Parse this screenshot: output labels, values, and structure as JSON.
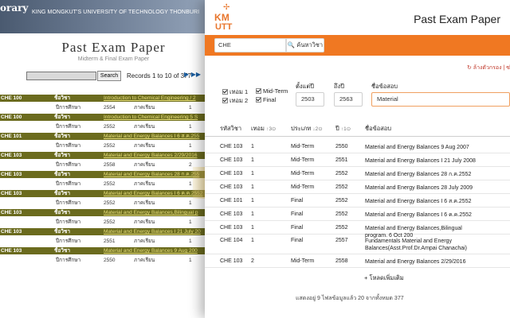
{
  "old_page": {
    "brand": "orary",
    "university": "KING MONGKUT'S UNIVERSITY OF TECHNOLOGY THONBURI",
    "title": "Past Exam Paper",
    "subtitle": "Midterm & Final Exam Paper",
    "search_button": "Search",
    "records_text": "Records 1 to 10 of 377",
    "nav_icons": "▶ ▶▶",
    "rows": [
      {
        "type": "h",
        "c1": "CHE 100",
        "c2": "ชื่อวิชา",
        "c3": "Introduction to Chemical Engineering / 2"
      },
      {
        "type": "d",
        "c2": "ปีการศึกษา",
        "c3": "2554",
        "c4": "ภาคเรียน",
        "c5": "1"
      },
      {
        "type": "h",
        "c1": "CHE 100",
        "c2": "ชื่อวิชา",
        "c3": "Introduction to Chemical Engineering 5 S"
      },
      {
        "type": "d",
        "c2": "ปีการศึกษา",
        "c3": "2552",
        "c4": "ภาคเรียน",
        "c5": "1"
      },
      {
        "type": "h",
        "c1": "CHE 101",
        "c2": "ชื่อวิชา",
        "c3": "Material and Energy Balances I 6 ส.ค.255"
      },
      {
        "type": "d",
        "c2": "ปีการศึกษา",
        "c3": "2552",
        "c4": "ภาคเรียน",
        "c5": "1"
      },
      {
        "type": "h",
        "c1": "CHE 103",
        "c2": "ชื่อวิชา",
        "c3": "Material and Energy Balances 2/29/2016"
      },
      {
        "type": "d",
        "c2": "ปีการศึกษา",
        "c3": "2558",
        "c4": "ภาคเรียน",
        "c5": "2"
      },
      {
        "type": "h",
        "c1": "CHE 103",
        "c2": "ชื่อวิชา",
        "c3": "Material and Energy Balances 28 ก.ค.255"
      },
      {
        "type": "d",
        "c2": "ปีการศึกษา",
        "c3": "2552",
        "c4": "ภาคเรียน",
        "c5": "1"
      },
      {
        "type": "h",
        "c1": "CHE 103",
        "c2": "ชื่อวิชา",
        "c3": "Material and Energy Balances I 6 ค.ค.2552"
      },
      {
        "type": "d",
        "c2": "ปีการศึกษา",
        "c3": "2552",
        "c4": "ภาคเรียน",
        "c5": "1"
      },
      {
        "type": "h",
        "c1": "CHE 103",
        "c2": "ชื่อวิชา",
        "c3": "Material and Energy Balances,Bilingual p"
      },
      {
        "type": "d",
        "c2": "ปีการศึกษา",
        "c3": "2552",
        "c4": "ภาคเรียน",
        "c5": "1"
      },
      {
        "type": "h",
        "c1": "CHE 103",
        "c2": "ชื่อวิชา",
        "c3": "Material and Energy Balances I 21 July 20"
      },
      {
        "type": "d",
        "c2": "ปีการศึกษา",
        "c3": "2551",
        "c4": "ภาคเรียน",
        "c5": "1"
      },
      {
        "type": "h",
        "c1": "CHE 103",
        "c2": "ชื่อวิชา",
        "c3": "Material and Energy Balances 9 Aug 200"
      },
      {
        "type": "d",
        "c2": "ปีการศึกษา",
        "c3": "2550",
        "c4": "ภาคเรียน",
        "c5": "1"
      }
    ]
  },
  "app": {
    "logo_text_top": "KM",
    "logo_text_bottom": "UTT",
    "title": "Past Exam Paper",
    "search": {
      "value": "CHE",
      "button": "🔍 ค้นหาวิชา"
    },
    "clear_filter": "↻ ล้างตัวกรอง | ซ่",
    "filters": {
      "checkbox_labels": [
        "เทอม 1",
        "เทอม 2",
        "Mid-Term",
        "Final"
      ],
      "from_label": "ตั้งแต่ปี",
      "from_value": "2503",
      "to_label": "ถึงปี",
      "to_value": "2563",
      "name_label": "ชื่อข้อสอบ",
      "name_value": "Material"
    },
    "table": {
      "headers": [
        {
          "label": "รหัสวิชา",
          "sort": ""
        },
        {
          "label": "เทอม",
          "sort": "↑3⊙"
        },
        {
          "label": "ประเภท",
          "sort": "↓2⊙"
        },
        {
          "label": "ปี",
          "sort": "↑1⊙"
        },
        {
          "label": "ชื่อข้อสอบ",
          "sort": ""
        }
      ],
      "rows": [
        {
          "code": "CHE 103",
          "term": "1",
          "type": "Mid-Term",
          "year": "2550",
          "name": "Material and Energy Balances 9 Aug 2007",
          "tall": false
        },
        {
          "code": "CHE 103",
          "term": "1",
          "type": "Mid-Term",
          "year": "2551",
          "name": "Material and Energy Balances I 21 July 2008",
          "tall": false
        },
        {
          "code": "CHE 103",
          "term": "1",
          "type": "Mid-Term",
          "year": "2552",
          "name": "Material and Energy Balances 28 ก.ค.2552",
          "tall": false
        },
        {
          "code": "CHE 103",
          "term": "1",
          "type": "Mid-Term",
          "year": "2552",
          "name": "Material and Energy Balances 28 July 2009",
          "tall": false
        },
        {
          "code": "CHE 101",
          "term": "1",
          "type": "Final",
          "year": "2552",
          "name": "Material and Energy Balances I 6 ส.ค.2552",
          "tall": false
        },
        {
          "code": "CHE 103",
          "term": "1",
          "type": "Final",
          "year": "2552",
          "name": "Material and Energy Balances I 6 ค.ค.2552",
          "tall": false
        },
        {
          "code": "CHE 103",
          "term": "1",
          "type": "Final",
          "year": "2552",
          "name": "Material and Energy Balances,Bilingual program. 6 Oct 200",
          "tall": false
        },
        {
          "code": "CHE 104",
          "term": "1",
          "type": "Final",
          "year": "2557",
          "name": "Fundamentals Material and Energy Balances(Asst.Prof.Dr.Ampai Chanachai)",
          "tall": true
        },
        {
          "code": "CHE 103",
          "term": "2",
          "type": "Mid-Term",
          "year": "2558",
          "name": "Material and Energy Balances 2/29/2016",
          "tall": false
        }
      ]
    },
    "load_more": "+ โหลดเพิ่มเติม",
    "footer": "แสดงอยู่ 9 ไฟลข้อมูลแล้ว 20 จากทั้งหมด 377"
  }
}
